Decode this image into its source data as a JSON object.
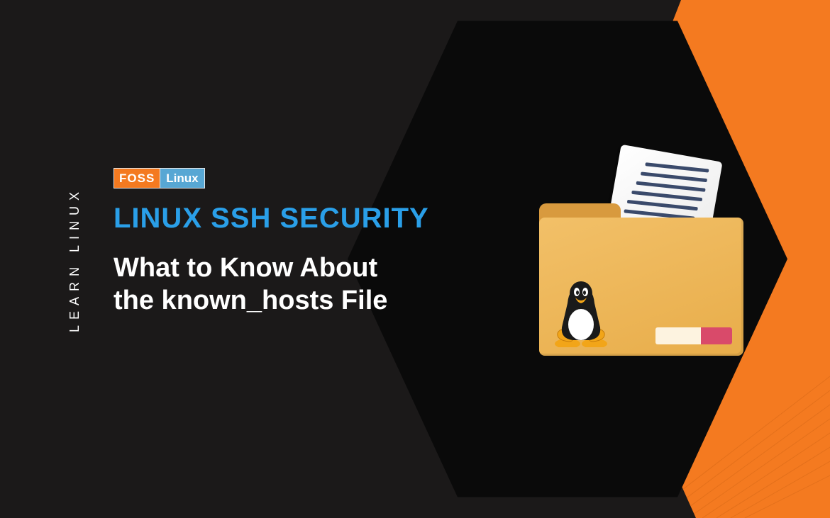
{
  "sideLabel": "LEARN LINUX",
  "logo": {
    "left": "FOSS",
    "right": "Linux"
  },
  "headline": "LINUX SSH SECURITY",
  "subtitleLine1": "What to Know About",
  "subtitleLine2": "the known_hosts File",
  "icons": {
    "folder": "folder-icon",
    "paper": "document-icon",
    "tux": "tux-linux-icon"
  },
  "colors": {
    "accent": "#f47a20",
    "headline": "#2a9fe8",
    "bg": "#1b1919",
    "hex": "#0a0a0a"
  }
}
